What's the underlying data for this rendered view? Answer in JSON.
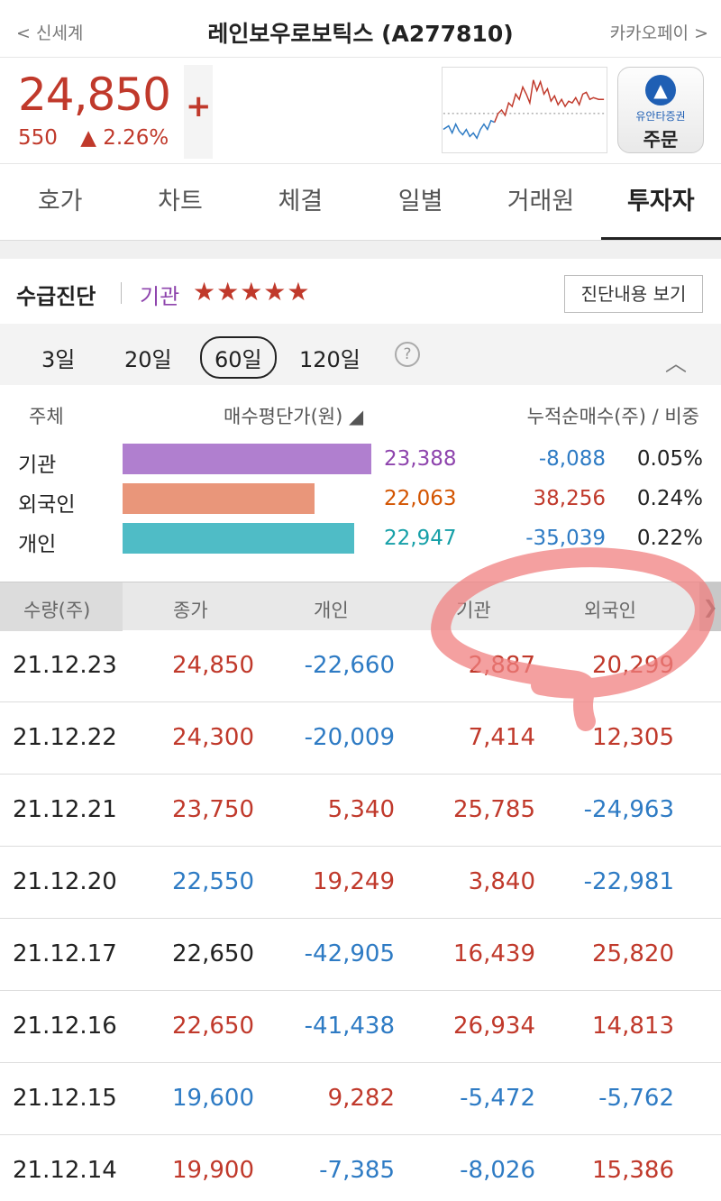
{
  "header": {
    "back_label": "< 신세계",
    "title": "레인보우로보틱스 (A277810)",
    "next_label": "카카오페이 >"
  },
  "quote": {
    "price": "24,850",
    "change_amount": "550",
    "change_pct": "▲ 2.26%",
    "plus_symbol": "+",
    "order_broker": "유안타증권",
    "order_label": "주문"
  },
  "tabs": [
    "호가",
    "차트",
    "체결",
    "일별",
    "거래원",
    "투자자"
  ],
  "diagnosis": {
    "label": "수급진단",
    "investor": "기관",
    "stars": "★★★★★",
    "rating_stars": 5,
    "button": "진단내용 보기"
  },
  "periods": [
    "3일",
    "20일",
    "60일",
    "120일"
  ],
  "selected_period": "60일",
  "help_icon": "?",
  "investor_summary": {
    "headers": {
      "subject": "주체",
      "avg_price": "매수평단가(원) ◢",
      "net": "누적순매수(주) / 비중"
    },
    "rows": [
      {
        "name": "기관",
        "avg": "23,388",
        "net": "-8,088",
        "pct": "0.05%",
        "color": "#b07fcf",
        "bar_fraction": 1.0
      },
      {
        "name": "외국인",
        "avg": "22,063",
        "net": "38,256",
        "pct": "0.24%",
        "color": "#e9967a",
        "bar_fraction": 0.77
      },
      {
        "name": "개인",
        "avg": "22,947",
        "net": "-35,039",
        "pct": "0.22%",
        "color": "#4fbcc6",
        "bar_fraction": 0.93
      }
    ]
  },
  "table": {
    "headers": [
      "수량(주)",
      "종가",
      "개인",
      "기관",
      "외국인"
    ],
    "rows": [
      {
        "date": "21.12.23",
        "close": "24,850",
        "ind": "-22,660",
        "inst": "2,887",
        "foreign": "20,299"
      },
      {
        "date": "21.12.22",
        "close": "24,300",
        "ind": "-20,009",
        "inst": "7,414",
        "foreign": "12,305"
      },
      {
        "date": "21.12.21",
        "close": "23,750",
        "ind": "5,340",
        "inst": "25,785",
        "foreign": "-24,963"
      },
      {
        "date": "21.12.20",
        "close": "22,550",
        "ind": "19,249",
        "inst": "3,840",
        "foreign": "-22,981"
      },
      {
        "date": "21.12.17",
        "close": "22,650",
        "ind": "-42,905",
        "inst": "16,439",
        "foreign": "25,820"
      },
      {
        "date": "21.12.16",
        "close": "22,650",
        "ind": "-41,438",
        "inst": "26,934",
        "foreign": "14,813"
      },
      {
        "date": "21.12.15",
        "close": "19,600",
        "ind": "9,282",
        "inst": "-5,472",
        "foreign": "-5,762"
      },
      {
        "date": "21.12.14",
        "close": "19,900",
        "ind": "-7,385",
        "inst": "-8,026",
        "foreign": "15,386"
      }
    ]
  },
  "colors": {
    "up": "#c0392b",
    "down": "#2e7bc4",
    "highlight": "#f08080"
  }
}
